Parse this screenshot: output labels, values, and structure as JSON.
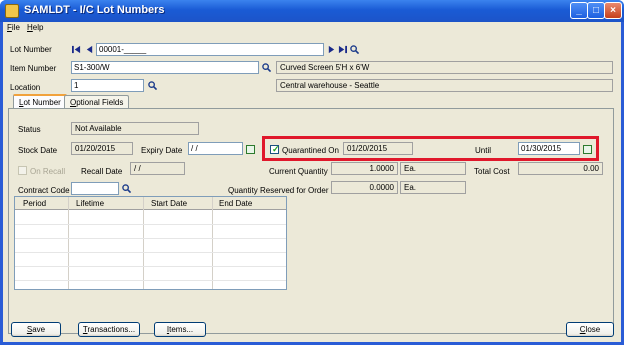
{
  "window": {
    "title": "SAMLDT - I/C Lot Numbers"
  },
  "menu": [
    {
      "label": "File",
      "key": "F",
      "rest": "ile"
    },
    {
      "label": "Help",
      "key": "H",
      "rest": "elp"
    }
  ],
  "header": {
    "lot_number_label": "Lot Number",
    "lot_number_value": "00001-_____",
    "item_number_label": "Item Number",
    "item_number_value": "S1-300/W",
    "item_description": "Curved Screen 5'H x 6'W",
    "location_label": "Location",
    "location_value": "1",
    "location_description": "Central warehouse - Seattle"
  },
  "tabs": [
    {
      "label": "Lot Number",
      "key": "L",
      "rest": "ot Number",
      "active": true
    },
    {
      "label": "Optional Fields",
      "key": "O",
      "rest": "ptional Fields",
      "active": false
    }
  ],
  "lot": {
    "status_label": "Status",
    "status_value": "Not Available",
    "stock_date_label": "Stock Date",
    "stock_date_value": "01/20/2015",
    "expiry_date_label": "Expiry Date",
    "expiry_date_value": "/ /",
    "quarantined_label": "Quarantined On",
    "quarantined_checked": true,
    "quarantined_value": "01/20/2015",
    "until_label": "Until",
    "until_value": "01/30/2015",
    "on_recall_label": "On Recall",
    "recall_date_label": "Recall Date",
    "recall_date_value": "/ /",
    "current_qty_label": "Current Quantity",
    "current_qty_value": "1.0000",
    "current_qty_unit": "Ea.",
    "total_cost_label": "Total Cost",
    "total_cost_value": "0.00",
    "contract_code_label": "Contract Code",
    "contract_code_value": "",
    "qty_reserved_label": "Quantity Reserved for Order",
    "qty_reserved_value": "0.0000",
    "qty_reserved_unit": "Ea."
  },
  "grid": {
    "columns": [
      "Period",
      "Lifetime",
      "Start Date",
      "End Date"
    ]
  },
  "buttons": {
    "save": {
      "label": "Save",
      "key": "S",
      "rest": "ave"
    },
    "transactions": {
      "label": "Transactions...",
      "key": "T",
      "rest": "ransactions..."
    },
    "items": {
      "label": "Items...",
      "key": "I",
      "rest": "tems..."
    },
    "close": {
      "label": "Close",
      "key": "C",
      "rest": "lose"
    }
  },
  "colors": {
    "title_bar": "#1c5bd5",
    "highlight_box": "#e0182b",
    "client_bg": "#ece9d8"
  },
  "icons": [
    "window-app-icon",
    "minimize-icon",
    "maximize-icon",
    "close-icon",
    "first-record-icon",
    "previous-record-icon",
    "next-record-icon",
    "last-record-icon",
    "finder-icon",
    "calendar-icon"
  ]
}
